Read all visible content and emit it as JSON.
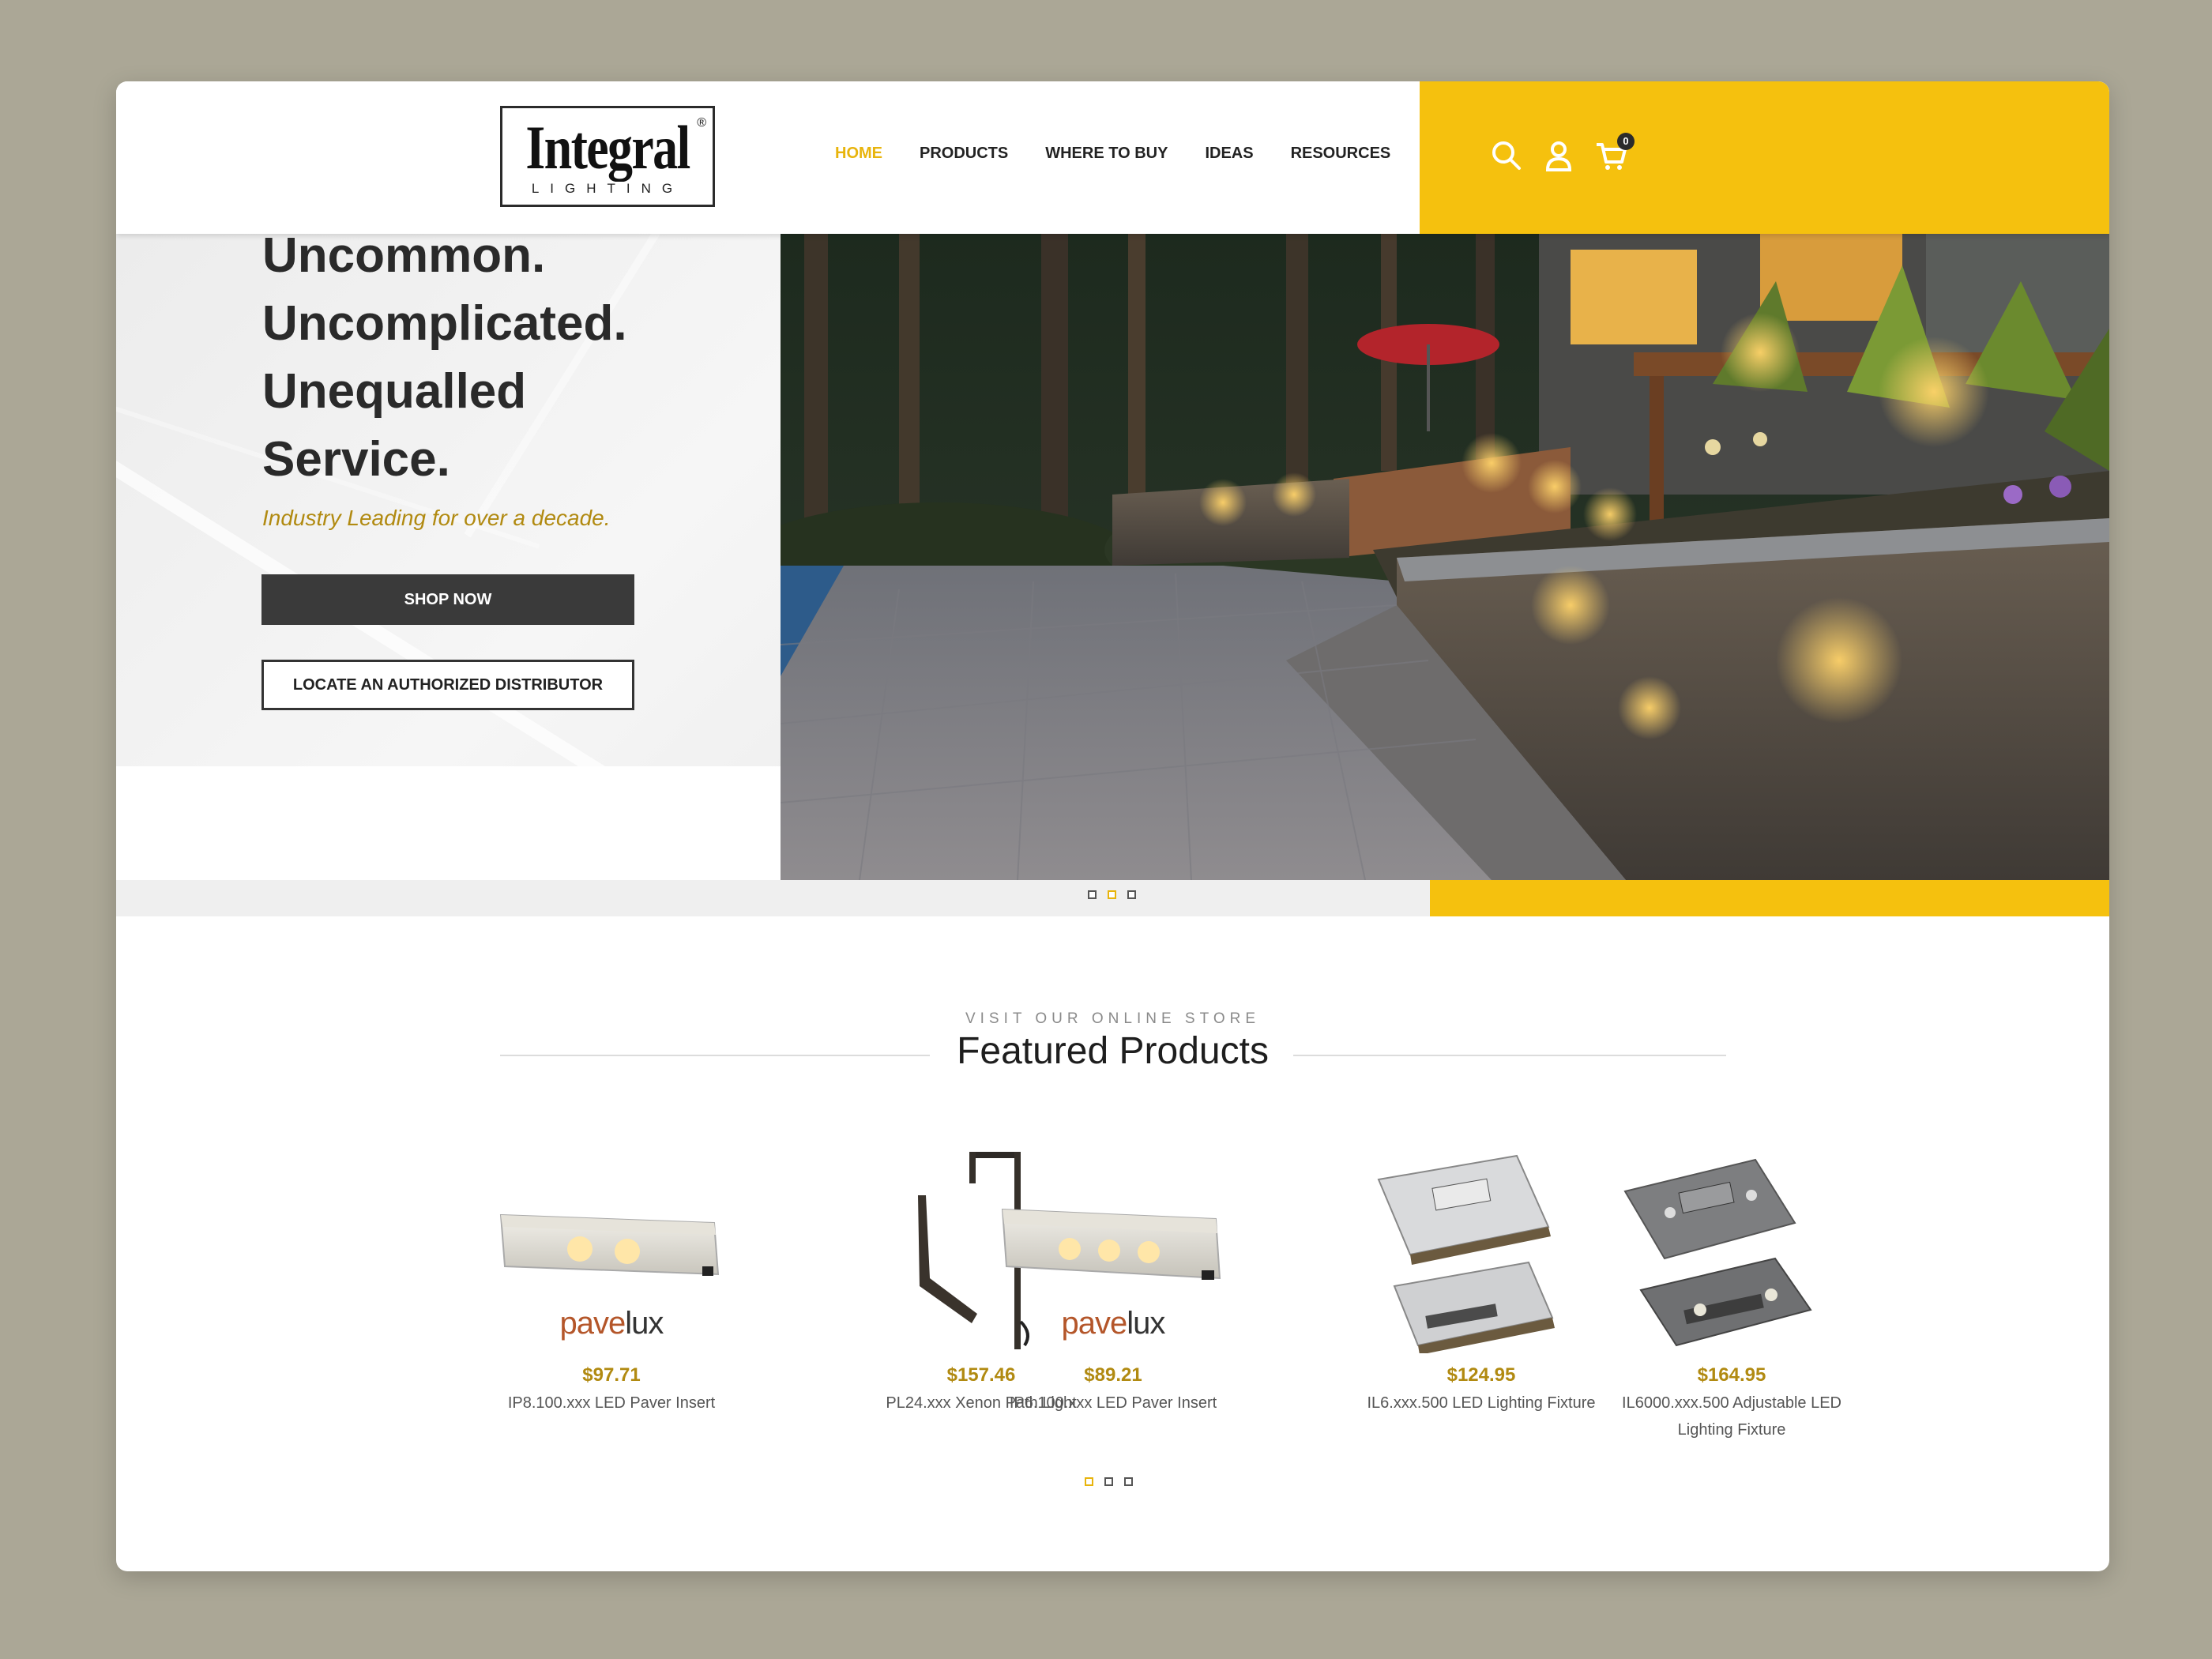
{
  "header": {
    "logo_text": "Integral",
    "logo_reg": "®",
    "logo_sub": "LIGHTING",
    "nav": [
      {
        "label": "HOME",
        "active": true
      },
      {
        "label": "PRODUCTS",
        "active": false
      },
      {
        "label": "WHERE TO BUY",
        "active": false
      },
      {
        "label": "IDEAS",
        "active": false
      },
      {
        "label": "RESOURCES",
        "active": false
      }
    ],
    "icons": [
      "search-icon",
      "user-icon",
      "cart-icon"
    ],
    "cart_count": "0",
    "accent_color": "#f5c10e"
  },
  "hero": {
    "title_lines": [
      "Uncommon.",
      "Uncomplicated.",
      "Unequalled",
      "Service."
    ],
    "subtitle": "Industry Leading for over a decade.",
    "primary_button": "SHOP NOW",
    "secondary_button": "LOCATE AN AUTHORIZED DISTRIBUTOR",
    "slide_count": 3,
    "active_slide": 2
  },
  "featured": {
    "eyebrow": "VISIT OUR ONLINE STORE",
    "title": "Featured Products",
    "products": [
      {
        "price": "$97.71",
        "name": "IP8.100.xxx LED Paver Insert",
        "brand": "pavelux",
        "brand_a": "pave",
        "brand_b": "lux"
      },
      {
        "price": "$157.46",
        "name": "PL24.xxx Xenon Path Light",
        "brand": ""
      },
      {
        "price": "$89.21",
        "name": "IP6.100.xxx LED Paver Insert",
        "brand": "pavelux",
        "brand_a": "pave",
        "brand_b": "lux"
      },
      {
        "price": "$124.95",
        "name": "IL6.xxx.500 LED Lighting Fixture",
        "brand": ""
      },
      {
        "price": "$164.95",
        "name": "IL6000.xxx.500 Adjustable LED Lighting Fixture",
        "brand": ""
      }
    ],
    "page_count": 3,
    "active_page": 1
  }
}
